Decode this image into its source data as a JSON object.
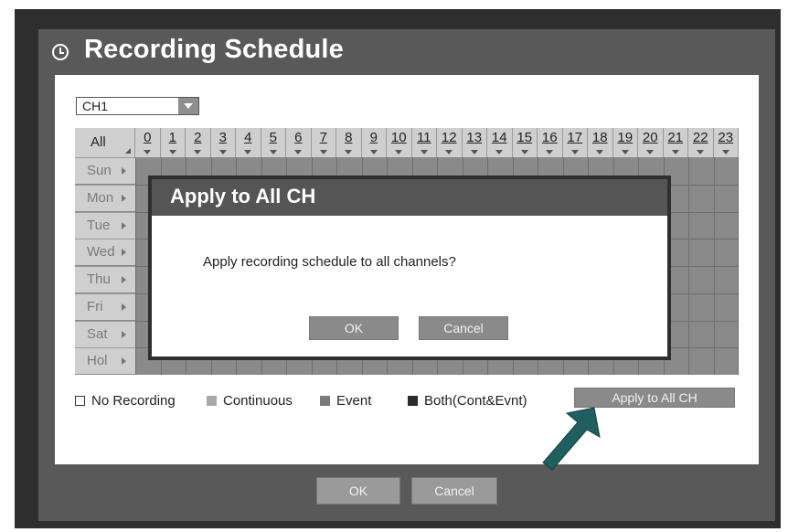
{
  "window": {
    "title": "Recording Schedule"
  },
  "channel_select": {
    "value": "CH1"
  },
  "grid": {
    "all_label": "All",
    "hours": [
      "0",
      "1",
      "2",
      "3",
      "4",
      "5",
      "6",
      "7",
      "8",
      "9",
      "10",
      "11",
      "12",
      "13",
      "14",
      "15",
      "16",
      "17",
      "18",
      "19",
      "20",
      "21",
      "22",
      "23"
    ],
    "days": [
      "Sun",
      "Mon",
      "Tue",
      "Wed",
      "Thu",
      "Fri",
      "Sat",
      "Hol"
    ]
  },
  "legend": {
    "no_recording": "No Recording",
    "continuous": "Continuous",
    "event": "Event",
    "both": "Both(Cont&Evnt)"
  },
  "buttons": {
    "apply_all": "Apply to All CH",
    "ok": "OK",
    "cancel": "Cancel"
  },
  "dialog": {
    "title": "Apply to All CH",
    "message": "Apply recording schedule to all channels?",
    "ok": "OK",
    "cancel": "Cancel"
  },
  "colors": {
    "no_recording": "#ffffff",
    "continuous": "#a9a9a9",
    "event": "#7b7b7b",
    "both": "#2b2b2b",
    "pointer_arrow": "#1f5f5f"
  }
}
